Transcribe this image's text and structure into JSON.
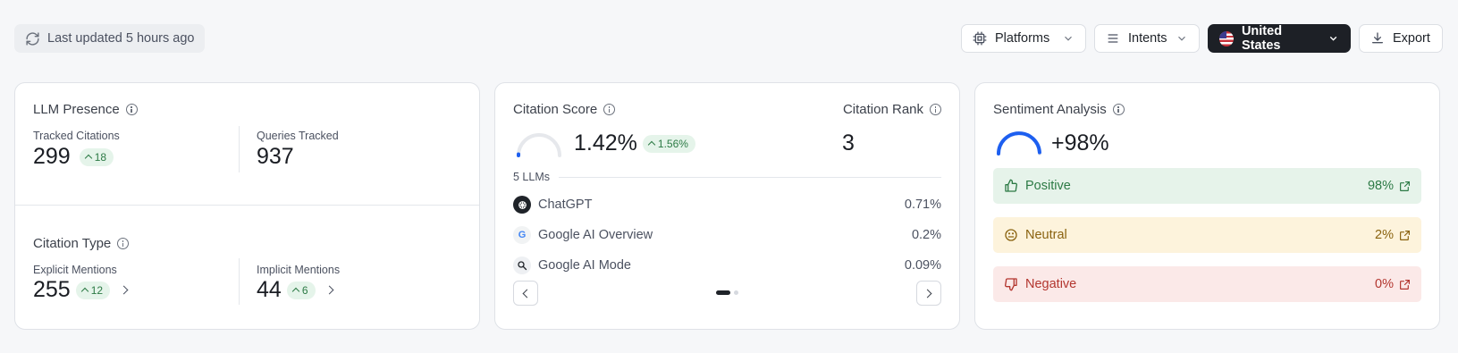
{
  "header": {
    "last_updated": "Last updated 5 hours ago",
    "filters": {
      "platforms": "Platforms",
      "intents": "Intents",
      "country": "United States",
      "export": "Export"
    }
  },
  "presence": {
    "title": "LLM Presence",
    "tracked_label": "Tracked Citations",
    "tracked_value": "299",
    "tracked_change": "18",
    "queries_label": "Queries Tracked",
    "queries_value": "937"
  },
  "citation_type": {
    "title": "Citation Type",
    "explicit_label": "Explicit Mentions",
    "explicit_value": "255",
    "explicit_change": "12",
    "implicit_label": "Implicit Mentions",
    "implicit_value": "44",
    "implicit_change": "6"
  },
  "citation": {
    "score_title": "Citation Score",
    "score_value": "1.42%",
    "score_change": "1.56%",
    "score_gauge_fraction": 0.0142,
    "rank_title": "Citation Rank",
    "rank_value": "3",
    "llm_count": "5 LLMs",
    "llms": [
      {
        "name": "ChatGPT",
        "value": "0.71%",
        "icon": "chatgpt-logo-icon"
      },
      {
        "name": "Google AI Overview",
        "value": "0.2%",
        "icon": "google-logo-icon"
      },
      {
        "name": "Google AI Mode",
        "value": "0.09%",
        "icon": "google-ai-mode-icon"
      }
    ],
    "page_index": 1,
    "page_count": 2
  },
  "sentiment": {
    "title": "Sentiment Analysis",
    "value": "+98%",
    "gauge_fraction": 0.98,
    "items": [
      {
        "label": "Positive",
        "value": "98%",
        "color": "#2c7a45",
        "bg": "#e6f3ea"
      },
      {
        "label": "Neutral",
        "value": "2%",
        "color": "#8a6310",
        "bg": "#fdf3dc"
      },
      {
        "label": "Negative",
        "value": "0%",
        "color": "#b3362f",
        "bg": "#fbe9e8"
      }
    ]
  },
  "colors": {
    "accent_blue": "#1d5ff0",
    "positive": "#2c7a45"
  }
}
